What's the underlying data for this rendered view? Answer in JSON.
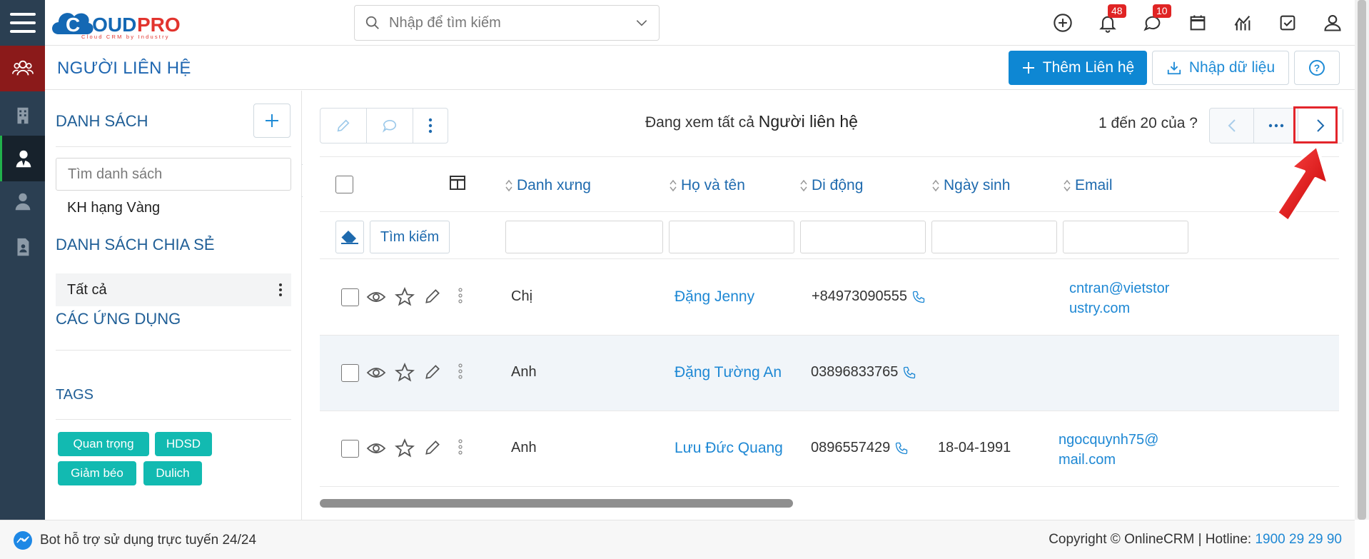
{
  "app": {
    "logo_text": "CLOUDPRO",
    "logo_tagline": "Cloud CRM by Industry",
    "search_placeholder": "Nhập để tìm kiếm",
    "notifications_count": "48",
    "messages_count": "10"
  },
  "page": {
    "title": "NGƯỜI LIÊN HỆ",
    "add_button": "Thêm Liên hệ",
    "import_button": "Nhập dữ liệu"
  },
  "sidebar": {
    "lists_heading": "DANH SÁCH",
    "list_search_placeholder": "Tìm danh sách",
    "lists": [
      "KH hạng Vàng"
    ],
    "shared_heading": "DANH SÁCH CHIA SẺ",
    "shared_items": [
      "Tất cả"
    ],
    "apps_heading": "CÁC ỨNG DỤNG",
    "tags_heading": "TAGS",
    "tags": [
      "Quan trọng",
      "HDSD",
      "Giảm béo",
      "Dulich"
    ]
  },
  "toolbar": {
    "viewing_prefix": "Đang xem tất cả",
    "viewing_module": "Người liên hệ",
    "pager_text": "1 đến 20 của",
    "pager_unknown": "?"
  },
  "table": {
    "columns": [
      "Danh xưng",
      "Họ và tên",
      "Di động",
      "Ngày sinh",
      "Email"
    ],
    "filter_search_label": "Tìm kiếm",
    "rows": [
      {
        "salutation": "Chị",
        "name": "Đặng Jenny",
        "mobile": "+84973090555",
        "birthday": "",
        "email_line1": "cntran@vietstor",
        "email_line2": "ustry.com"
      },
      {
        "salutation": "Anh",
        "name": "Đặng Tường An",
        "mobile": "03896833765",
        "birthday": "",
        "email_line1": "",
        "email_line2": ""
      },
      {
        "salutation": "Anh",
        "name": "Lưu Đức Quang",
        "mobile": "0896557429",
        "birthday": "18-04-1991",
        "email_line1": "ngocquynh75@",
        "email_line2": "mail.com"
      }
    ]
  },
  "footer": {
    "bot_text": "Bot hỗ trợ sử dụng trực tuyến 24/24",
    "copyright": "Copyright © OnlineCRM",
    "separator": "|",
    "hotline_label": "Hotline:",
    "hotline_number": "1900 29 29 90"
  },
  "colors": {
    "primary": "#0e87d3",
    "rail": "#2b3f52",
    "rail_active": "#8b1a1a",
    "tag": "#12bab1",
    "highlight": "#e3252b"
  }
}
